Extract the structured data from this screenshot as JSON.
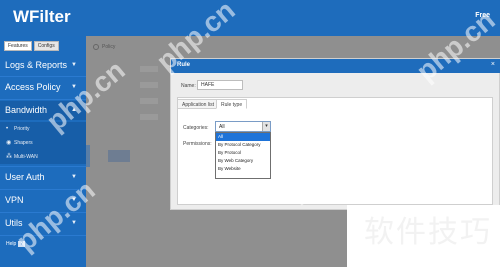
{
  "app": {
    "brand": "WFilter",
    "user": "Free"
  },
  "sidebar": {
    "tabs": [
      {
        "label": "Features"
      },
      {
        "label": "Configs"
      }
    ],
    "items": [
      {
        "label": "Logs & Reports"
      },
      {
        "label": "Access Policy"
      },
      {
        "label": "Bandwidth"
      },
      {
        "label": "User Auth"
      },
      {
        "label": "VPN"
      },
      {
        "label": "Utils"
      }
    ],
    "subitems": [
      {
        "label": "Priority",
        "icon": "•"
      },
      {
        "label": "Shapers",
        "icon": "◉"
      },
      {
        "label": "Multi-WAN",
        "icon": "⁂"
      }
    ],
    "footer": {
      "label": "Help",
      "badge": "?"
    }
  },
  "background": {
    "title": "Policy"
  },
  "modal": {
    "title": "Rule",
    "close": "×",
    "name_label": "Name:",
    "name_value": "HAFE",
    "tabs": [
      {
        "label": "Application list"
      },
      {
        "label": "Rule type"
      }
    ],
    "category_label": "Categories:",
    "action_label": "Permissions:",
    "select_value": "All",
    "select_arrow": "▾",
    "options": [
      "All",
      "By Protocol Category",
      "By Protocol",
      "By Web Category",
      "By Website"
    ]
  },
  "watermarks": {
    "a": "php.cn",
    "b": "php.cn",
    "c": "php.cn",
    "d": "php.cn",
    "e": "php.cn",
    "cn": "软件技巧"
  },
  "colors": {
    "topbar": "#1e6cbc",
    "sidebar": "#1d6cbd",
    "highlight": "#1e73d8"
  }
}
